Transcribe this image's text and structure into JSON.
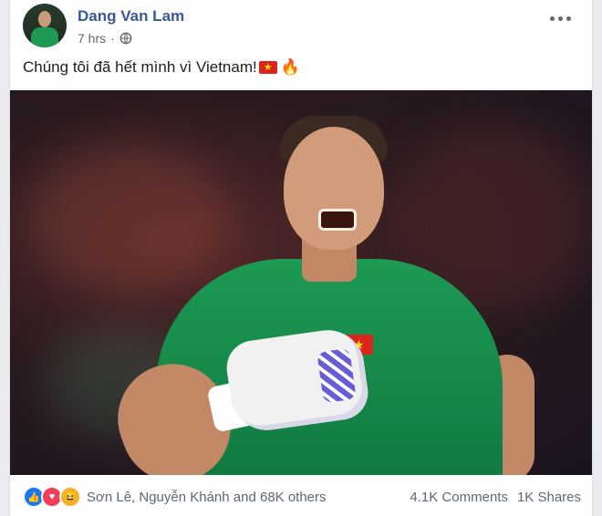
{
  "post": {
    "author": "Dang Van Lam",
    "time": "7 hrs",
    "privacy_icon": "globe-icon",
    "caption": "Chúng tôi đã hết mình vì Vietnam!",
    "caption_icons": [
      "vietnam-flag-icon",
      "fire-icon"
    ]
  },
  "reactions": {
    "icons": [
      "like-icon",
      "love-icon",
      "haha-icon"
    ],
    "names": "Sơn Lê, Nguyễn Khánh and 68K others",
    "comments": "4.1K Comments",
    "shares": "1K Shares"
  },
  "colors": {
    "author": "#385898",
    "like": "#1877f2",
    "love": "#f33e58",
    "haha": "#f7b125",
    "jersey": "#1d9a54"
  }
}
